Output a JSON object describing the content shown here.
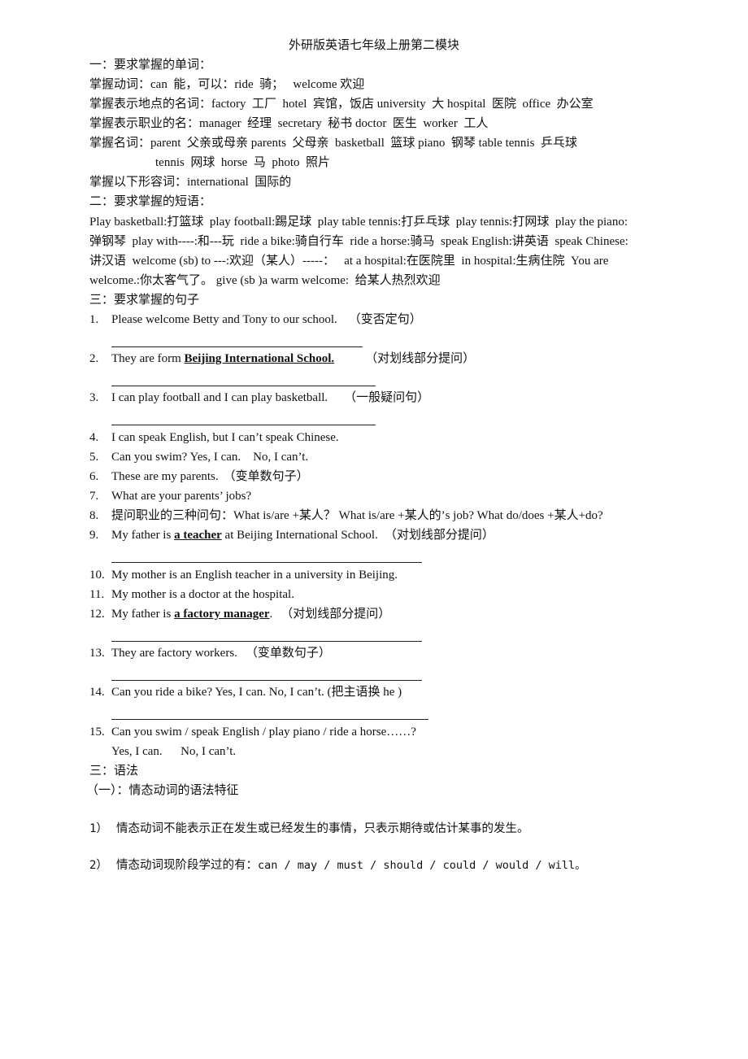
{
  "title": "外研版英语七年级上册第二模块",
  "section1": {
    "heading": "一：要求掌握的单词：",
    "verbs": "掌握动词：can  能，可以：ride  骑；   welcome 欢迎",
    "places": "掌握表示地点的名词：factory  工厂  hotel  宾馆，饭店 university  大 hospital  医院  office  办公室",
    "jobs": "掌握表示职业的名：manager  经理  secretary  秘书 doctor  医生  worker  工人",
    "nouns_1": "掌握名词：parent  父亲或母亲 parents  父母亲  basketball  篮球 piano  钢琴 table tennis  乒乓球",
    "nouns_2": "tennis  网球  horse  马  photo  照片",
    "adjectives": "掌握以下形容词：international  国际的"
  },
  "section2": {
    "heading": "二：要求掌握的短语：",
    "lines": [
      "Play basketball:打篮球  play football:踢足球  play table tennis:打乒乓球  play tennis:打网球  play the piano:",
      "弹钢琴  play with----:和---玩  ride a bike:骑自行车  ride a horse:骑马  speak English:讲英语  speak Chinese:",
      "讲汉语  welcome (sb) to ---:欢迎（某人）-----：   at a hospital:在医院里  in hospital:生病住院  You are",
      "welcome.:你太客气了。 give (sb )a warm welcome:  给某人热烈欢迎"
    ]
  },
  "section3": {
    "heading": "三：要求掌握的句子",
    "items": [
      {
        "num": "1.",
        "pre": "Please welcome Betty and Tony to our school.",
        "underlined": "",
        "post": "",
        "note": "（变否定句）"
      },
      {
        "num": "2.",
        "pre": "They are form ",
        "underlined": "Beijing International School.",
        "post": "",
        "note": "（对划线部分提问）"
      },
      {
        "num": "3.",
        "pre": "I can play football and I can play basketball.",
        "underlined": "",
        "post": "",
        "note": "（一般疑问句）"
      },
      {
        "num": "4.",
        "pre": "I can speak English, but I can’t speak Chinese.",
        "underlined": "",
        "post": "",
        "note": ""
      },
      {
        "num": "5.",
        "pre": "Can you swim? Yes, I can.    No, I can’t.",
        "underlined": "",
        "post": "",
        "note": ""
      },
      {
        "num": "6.",
        "pre": "These are my parents.",
        "underlined": "",
        "post": "",
        "note": "（变单数句子）"
      },
      {
        "num": "7.",
        "pre": "What are your parents’ jobs?",
        "underlined": "",
        "post": "",
        "note": ""
      },
      {
        "num": "8.",
        "pre": "提问职业的三种问句：What is/are +某人？ What is/are +某人的’s job? What do/does +某人+do?",
        "underlined": "",
        "post": "",
        "note": ""
      },
      {
        "num": "9.",
        "pre": "My father is ",
        "underlined": "a teacher",
        "post": " at Beijing International School.",
        "note": "（对划线部分提问）"
      },
      {
        "num": "10.",
        "pre": "My mother is an English teacher in a university in Beijing.",
        "underlined": "",
        "post": "",
        "note": ""
      },
      {
        "num": "11.",
        "pre": "My mother is a doctor at the hospital.",
        "underlined": "",
        "post": "",
        "note": ""
      },
      {
        "num": "12.",
        "pre": "My father is ",
        "underlined": "a factory manager",
        "post": ".",
        "note": "（对划线部分提问）"
      },
      {
        "num": "13.",
        "pre": "They are factory workers.",
        "underlined": "",
        "post": "",
        "note": "（变单数句子）"
      },
      {
        "num": "14.",
        "pre": "Can you ride a bike? Yes, I can. No, I can’t. (把主语换 he )",
        "underlined": "",
        "post": "",
        "note": ""
      },
      {
        "num": "15.",
        "pre": "Can you swim / speak English / play piano / ride a horse……?",
        "underlined": "",
        "post": "",
        "note": ""
      }
    ],
    "item15_answer": "Yes, I can.      No, I can’t."
  },
  "section4": {
    "heading": "三：语法",
    "subheading": "（一）：情态动词的语法特征",
    "points": [
      {
        "num": "1）",
        "text": "情态动词不能表示正在发生或已经发生的事情，只表示期待或估计某事的发生。"
      },
      {
        "num": "2）",
        "text": "情态动词现阶段学过的有：",
        "mono": "can / may / must / should / could / would / will。"
      }
    ]
  }
}
